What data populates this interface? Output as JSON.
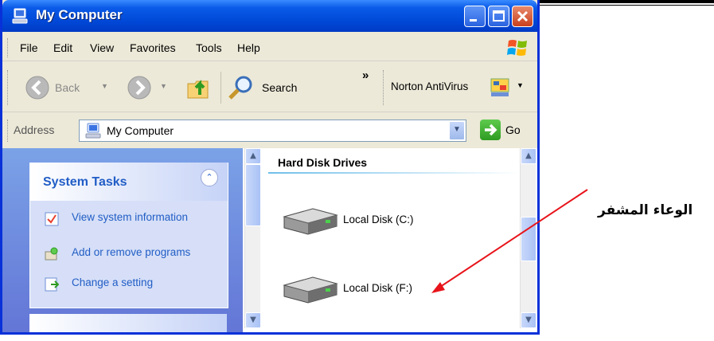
{
  "window": {
    "title": "My Computer"
  },
  "menu": {
    "file": "File",
    "edit": "Edit",
    "view": "View",
    "favorites": "Favorites",
    "tools": "Tools",
    "help": "Help"
  },
  "toolbar": {
    "back": "Back",
    "search": "Search",
    "chevron": "»",
    "norton": "Norton AntiVirus"
  },
  "address": {
    "label": "Address",
    "value": "My Computer",
    "go": "Go"
  },
  "tasks": {
    "title": "System Tasks",
    "items": [
      "View system information",
      "Add or remove programs",
      "Change a setting"
    ]
  },
  "drives": {
    "section": "Hard Disk Drives",
    "items": [
      "Local Disk (C:)",
      "Local Disk (F:)"
    ]
  },
  "annotation": {
    "text": "الوعاء المشفر",
    "arrow_color": "#E8141B"
  },
  "colors": {
    "title_bar": "#0A5AE8",
    "task_pane": "#7BA2E7",
    "task_link": "#215DC6"
  }
}
